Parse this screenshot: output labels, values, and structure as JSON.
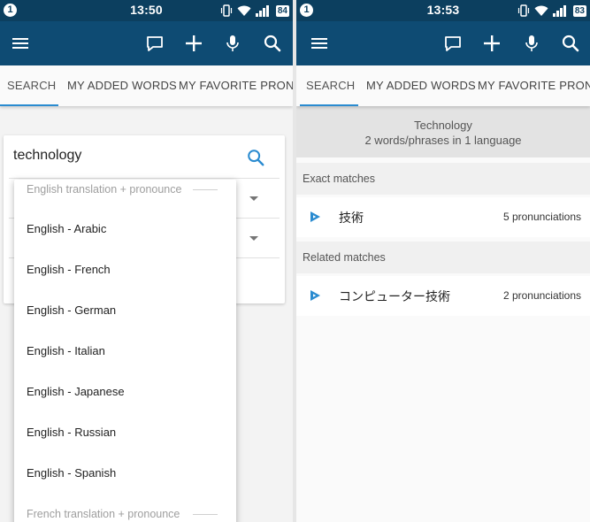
{
  "left": {
    "status": {
      "notification": "1",
      "time": "13:50",
      "battery": "84"
    },
    "tabs": [
      "SEARCH",
      "MY ADDED WORDS",
      "MY FAVORITE PRONUNCI"
    ],
    "search": {
      "value": "technology"
    },
    "dropdown": {
      "header_top": "English translation + pronounce",
      "items": [
        "English - Arabic",
        "English - French",
        "English - German",
        "English - Italian",
        "English - Japanese",
        "English - Russian",
        "English - Spanish"
      ],
      "header_bottom": "French translation + pronounce"
    }
  },
  "right": {
    "status": {
      "notification": "1",
      "time": "13:53",
      "battery": "83"
    },
    "tabs": [
      "SEARCH",
      "MY ADDED WORDS",
      "MY FAVORITE PRONUNCI"
    ],
    "summary": {
      "title": "Technology",
      "subtitle": "2 words/phrases in 1 language"
    },
    "exact_header": "Exact matches",
    "exact": [
      {
        "word": "技術",
        "count": "5 pronunciations"
      }
    ],
    "related_header": "Related matches",
    "related": [
      {
        "word": "コンピューター技術",
        "count": "2 pronunciations"
      }
    ]
  },
  "colors": {
    "status_bar": "#0c3f5f",
    "app_bar": "#0e4b73",
    "accent": "#2a8bd0"
  }
}
